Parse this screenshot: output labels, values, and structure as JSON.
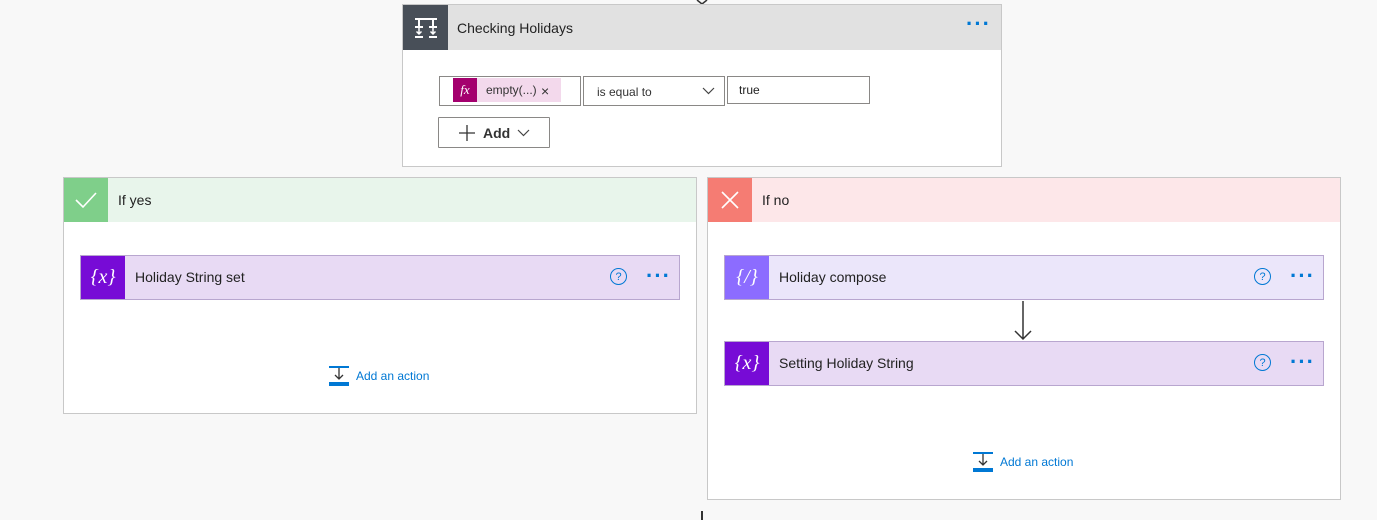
{
  "condition": {
    "title": "Checking Holidays",
    "expression_token": "empty(...)",
    "remove_token_glyph": "×",
    "fx_label": "fx",
    "operator": "is equal to",
    "value": "true",
    "add_label": "Add",
    "icon": "condition-icon"
  },
  "branches": {
    "yes": {
      "title": "If yes",
      "actions": [
        {
          "title": "Holiday String set",
          "icon": "variable-icon",
          "glyph": "{x}"
        }
      ],
      "add_action_label": "Add an action"
    },
    "no": {
      "title": "If no",
      "actions": [
        {
          "title": "Holiday compose",
          "icon": "compose-icon",
          "glyph": "{/}"
        },
        {
          "title": "Setting Holiday String",
          "icon": "variable-icon",
          "glyph": "{x}"
        }
      ],
      "add_action_label": "Add an action"
    }
  },
  "common": {
    "help_glyph": "?",
    "more_glyph": "···"
  },
  "colors": {
    "accent": "#0078d4",
    "condition_header": "#e1e1e1",
    "condition_icon_bg": "#484f58",
    "yes_header": "#e8f5eb",
    "yes_icon": "#7fcf8a",
    "no_header": "#fde7e9",
    "no_icon": "#f57c73",
    "variable_card": "#e8daf4",
    "variable_icon": "#770bd6",
    "compose_card": "#ebe6fa",
    "compose_icon": "#8c6cff",
    "expression_icon": "#a4006e"
  }
}
